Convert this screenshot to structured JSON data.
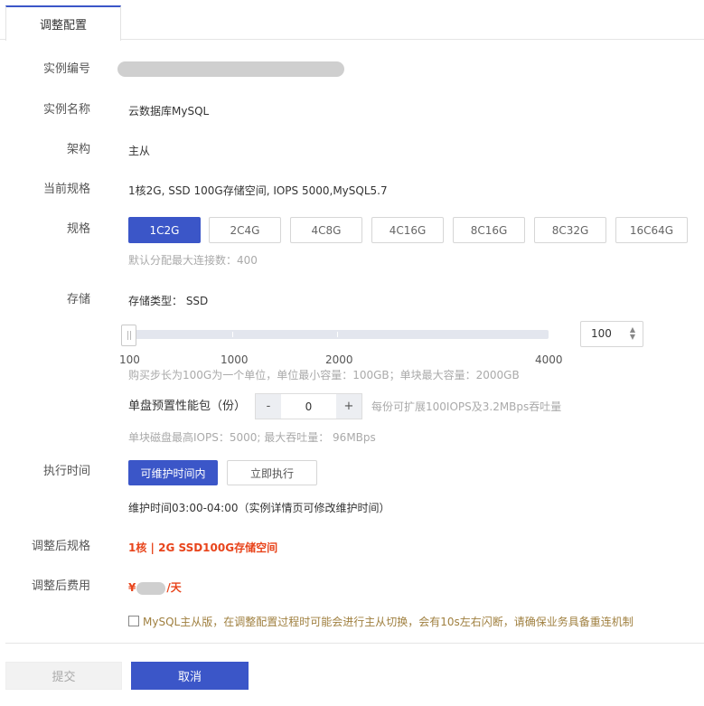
{
  "tabs": {
    "active_label": "调整配置"
  },
  "labels": {
    "instance_id": "实例编号",
    "instance_name": "实例名称",
    "architecture": "架构",
    "current_spec": "当前规格",
    "spec": "规格",
    "storage": "存储",
    "exec_time": "执行时间",
    "after_spec": "调整后规格",
    "after_cost": "调整后费用"
  },
  "values": {
    "instance_name": "云数据库MySQL",
    "architecture": "主从",
    "current_spec": "1核2G, SSD 100G存储空间, IOPS 5000,MySQL5.7"
  },
  "spec_options": [
    {
      "label": "1C2G",
      "active": true
    },
    {
      "label": "2C4G",
      "active": false
    },
    {
      "label": "4C8G",
      "active": false
    },
    {
      "label": "4C16G",
      "active": false
    },
    {
      "label": "8C16G",
      "active": false
    },
    {
      "label": "8C32G",
      "active": false
    },
    {
      "label": "16C64G",
      "active": false
    }
  ],
  "spec_hint": "默认分配最大连接数：400",
  "storage": {
    "type_text": "存储类型：  SSD",
    "slider_value": 100,
    "slider_min": 100,
    "slider_max": 4000,
    "ticks": [
      "100",
      "1000",
      "2000",
      "4000"
    ],
    "input_value": "100",
    "hint": "购买步长为100G为一个单位，单位最小容量：100GB；单块最大容量：2000GB"
  },
  "perf_pack": {
    "label": "单盘预置性能包（份）",
    "minus": "-",
    "plus": "+",
    "qty": "0",
    "hint": "每份可扩展100IOPS及3.2MBps吞吐量",
    "limit": "单块磁盘最高IOPS：5000; 最大吞吐量： 96MBps"
  },
  "exec": {
    "maintenance_btn": "可维护时间内",
    "immediate_btn": "立即执行",
    "note": "维护时间03:00-04:00（实例详情页可修改维护时间）"
  },
  "after": {
    "spec": "1核 | 2G SSD100G存储空间",
    "currency": "¥",
    "unit": "/天"
  },
  "warning": "MySQL主从版，在调整配置过程时可能会进行主从切换，会有10s左右闪断，请确保业务具备重连机制",
  "footer": {
    "submit": "提交",
    "cancel": "取消"
  },
  "colors": {
    "primary": "#3b56c8",
    "price": "#e8441b",
    "warning": "#a08040"
  }
}
